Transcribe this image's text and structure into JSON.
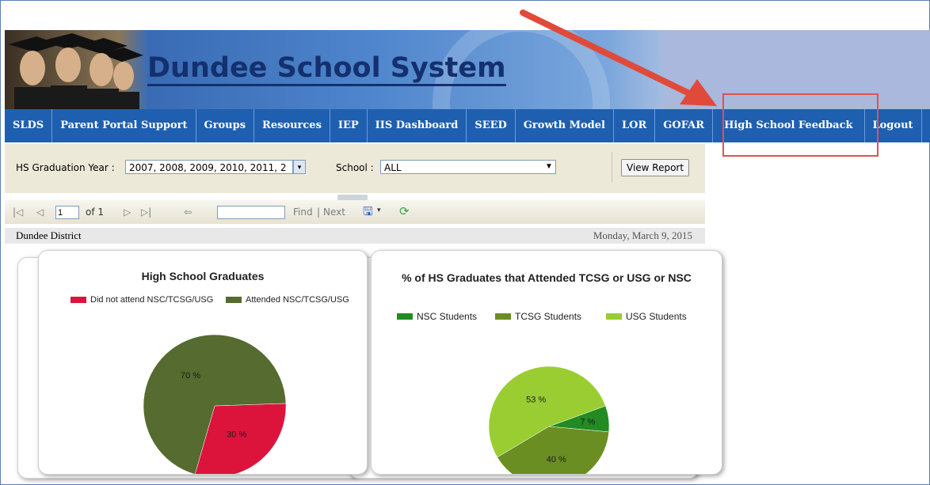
{
  "header": {
    "title": "Dundee School System"
  },
  "nav": {
    "items": [
      "SLDS",
      "Parent Portal Support",
      "Groups",
      "Resources",
      "IEP",
      "IIS Dashboard",
      "SEED",
      "Growth Model",
      "LOR",
      "GOFAR",
      "High School Feedback",
      "Logout"
    ]
  },
  "params": {
    "grad_year_label": "HS Graduation Year :",
    "grad_year_value": "2007, 2008, 2009, 2010, 2011, 2",
    "school_label": "School :",
    "school_value": "ALL",
    "view_report": "View Report"
  },
  "toolbar": {
    "page": "1",
    "of_pages": "of 1",
    "find": "Find",
    "sep": "|",
    "next": "Next"
  },
  "report": {
    "district": "Dundee District",
    "date": "Monday, March 9, 2015"
  },
  "colors": {
    "red": "#dc143c",
    "dark_olive": "#556b2f",
    "nsc": "#228b22",
    "tcsg": "#6b8e23",
    "usg": "#9acd32"
  },
  "chart_data": [
    {
      "type": "pie",
      "title": "High School Graduates",
      "categories": [
        "Did not attend NSC/TCSG/USG",
        "Attended NSC/TCSG/USG"
      ],
      "values": [
        30,
        70
      ],
      "labels": [
        "30 %",
        "70 %"
      ],
      "colors": [
        "#dc143c",
        "#556b2f"
      ],
      "legend": "top"
    },
    {
      "type": "pie",
      "title": "% of HS Graduates that Attended TCSG or USG or NSC",
      "categories": [
        "NSC Students",
        "TCSG Students",
        "USG Students"
      ],
      "values": [
        7,
        40,
        53
      ],
      "labels": [
        "7 %",
        "40 %",
        "53 %"
      ],
      "colors": [
        "#228b22",
        "#6b8e23",
        "#9acd32"
      ],
      "legend": "top"
    }
  ]
}
